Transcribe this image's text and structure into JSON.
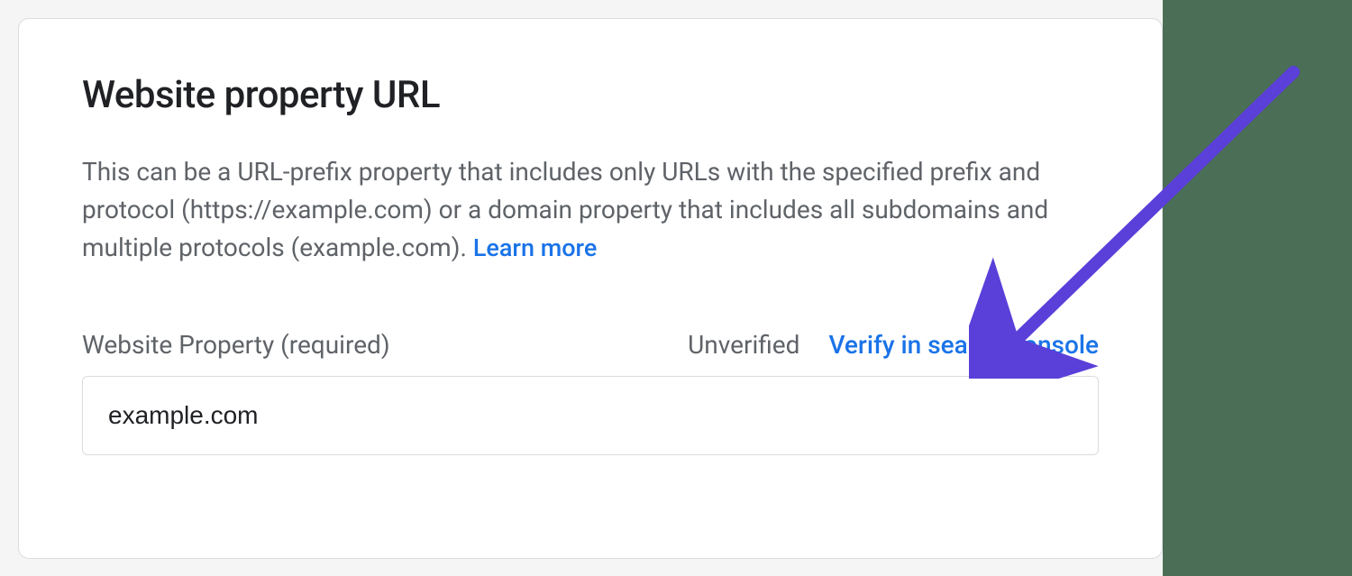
{
  "card": {
    "title": "Website property URL",
    "description": "This can be a URL-prefix property that includes only URLs with the specified prefix and protocol (https://example.com) or a domain property that includes all subdomains and multiple protocols (example.com). ",
    "learn_more": "Learn more",
    "field_label": "Website Property (required)",
    "status": "Unverified",
    "verify_link": "Verify in search console",
    "input_value": "example.com"
  }
}
